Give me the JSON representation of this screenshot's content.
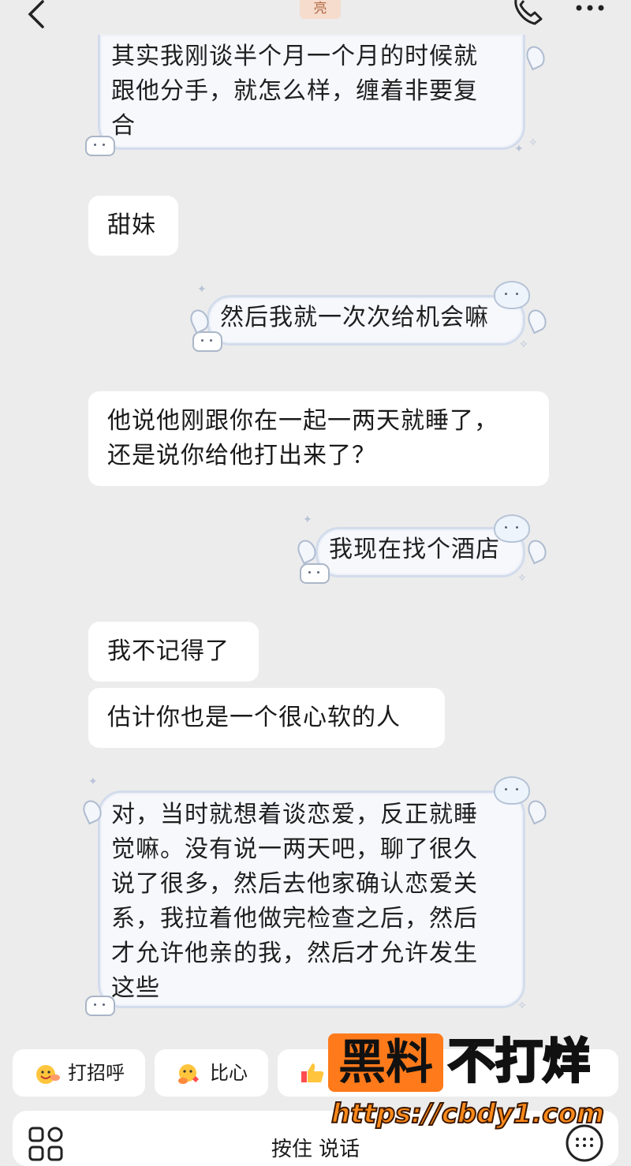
{
  "header": {
    "title_fragment": "亮",
    "back_icon": "chevron-left-icon",
    "call_icon": "phone-icon",
    "more_icon": "more-dots-icon"
  },
  "messages": [
    {
      "side": "right",
      "style": "sticker-bubble",
      "lines": [
        "其实我刚谈半个月一个月的时候就",
        "跟他分手，就怎么样，缠着非要复",
        "合"
      ]
    },
    {
      "side": "left",
      "style": "plain",
      "lines": [
        "甜妹"
      ]
    },
    {
      "side": "right",
      "style": "sticker-bubble",
      "lines": [
        "然后我就一次次给机会嘛"
      ]
    },
    {
      "side": "left",
      "style": "plain",
      "lines": [
        "他说他刚跟你在一起一两天就睡了，",
        "还是说你给他打出来了？"
      ]
    },
    {
      "side": "right",
      "style": "sticker-bubble",
      "lines": [
        "我现在找个酒店"
      ]
    },
    {
      "side": "left",
      "style": "plain",
      "lines": [
        "我不记得了"
      ]
    },
    {
      "side": "left",
      "style": "plain",
      "lines": [
        "估计你也是一个很心软的人"
      ]
    },
    {
      "side": "right",
      "style": "sticker-bubble",
      "lines": [
        "对，当时就想着谈恋爱，反正就睡",
        "觉嘛。没有说一两天吧，聊了很久",
        "说了很多，然后去他家确认恋爱关",
        "系，我拉着他做完检查之后，然后",
        "才允许他亲的我，然后才允许发生",
        "这些"
      ]
    }
  ],
  "quick_replies": [
    {
      "label": "打招呼",
      "icon": "wave-emoji-icon"
    },
    {
      "label": "比心",
      "icon": "heart-hands-emoji-icon"
    },
    {
      "label": "",
      "icon": "thumbs-up-emoji-icon"
    }
  ],
  "input_bar": {
    "hold_to_talk": "按住 说话",
    "apps_icon": "apps-grid-icon",
    "keyboard_icon": "keyboard-icon"
  },
  "watermark": {
    "box_text": "黑料",
    "text": "不打烊",
    "url": "https://cbdy1.com"
  },
  "colors": {
    "background": "#ececec",
    "plain_bubble": "#ffffff",
    "sticker_bubble_border": "#d3dcec",
    "watermark_orange": "#ff7a1a"
  }
}
